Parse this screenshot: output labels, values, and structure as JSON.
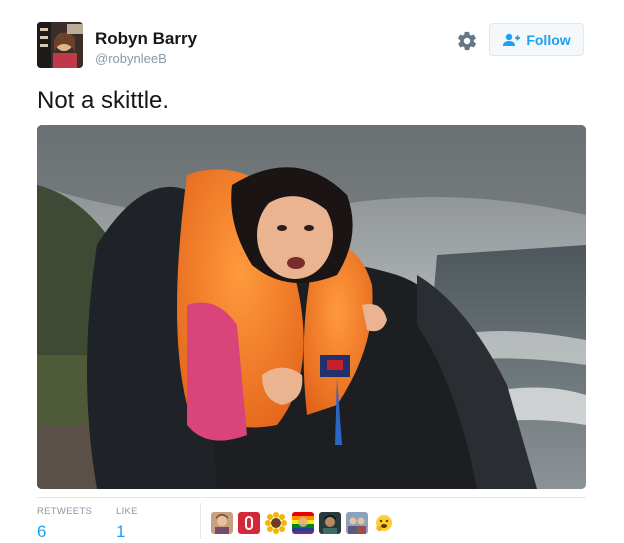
{
  "author": {
    "name": "Robyn Barry",
    "handle": "@robynleeB",
    "avatar_icon": "profile-avatar"
  },
  "actions": {
    "settings_icon": "gear-icon",
    "follow_label": "Follow",
    "follow_icon": "add-user-icon"
  },
  "tweet": {
    "text": "Not a skittle."
  },
  "media": {
    "description_icon": "photo"
  },
  "stats": {
    "retweets_label": "RETWEETS",
    "retweets_count": "6",
    "likes_label": "LIKE",
    "likes_count": "1"
  },
  "likers": [
    {
      "icon": "liker-avatar-1"
    },
    {
      "icon": "liker-avatar-2"
    },
    {
      "icon": "liker-avatar-3"
    },
    {
      "icon": "liker-avatar-4"
    },
    {
      "icon": "liker-avatar-5"
    },
    {
      "icon": "liker-avatar-6"
    },
    {
      "icon": "liker-avatar-7"
    }
  ],
  "colors": {
    "link_blue": "#1da1f2",
    "muted_gray": "#8899a6",
    "border": "#e1e8ed"
  }
}
